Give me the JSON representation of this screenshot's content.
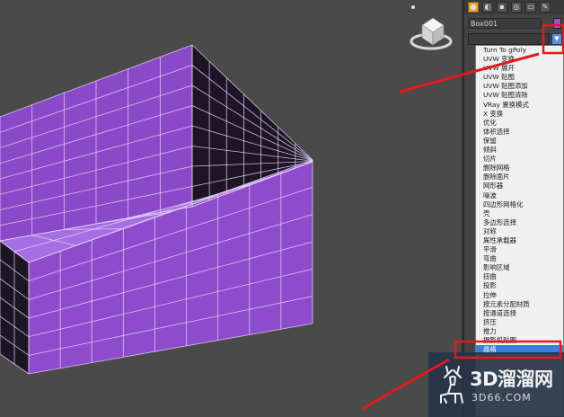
{
  "object": {
    "name": "Box001"
  },
  "modifier_list": {
    "items": [
      "Turn To gPoly",
      "UVW 变换",
      "UVW 展开",
      "UVW 贴图",
      "UVW 贴图添加",
      "UVW 贴图清除",
      "VRay 置换模式",
      "X 变换",
      "优化",
      "体积选择",
      "保留",
      "倾斜",
      "切片",
      "删除网格",
      "删除面片",
      "网形器",
      "噪波",
      "四边形网格化",
      "壳",
      "多边形选择",
      "对称",
      "属性承载器",
      "平滑",
      "弯曲",
      "影响区域",
      "扭曲",
      "投影",
      "拉伸",
      "按元素分配材质",
      "按通道选择",
      "挤压",
      "推力",
      "摄影机贴图",
      "晶格"
    ],
    "selected_index": 33
  },
  "watermark": {
    "brand": "3D溜溜网",
    "site": "3D66.COM"
  },
  "colors": {
    "object_color": "#9a4fd6",
    "annotation": "#e11b1b",
    "selection": "#3b7fd9"
  },
  "icons": [
    "view-cube-icon",
    "create-tab-icon",
    "modify-tab-icon",
    "hierarchy-tab-icon",
    "motion-tab-icon",
    "display-tab-icon",
    "utilities-tab-icon",
    "dropdown-arrow-icon",
    "deer-logo-icon"
  ]
}
